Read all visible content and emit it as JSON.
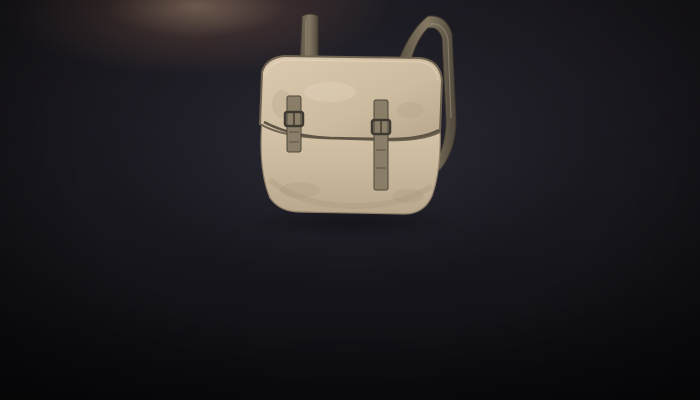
{
  "scene": {
    "item_icon": "canvas-backpack-icon",
    "background_color": "#16151b",
    "glow_color": "#e8b991",
    "canvas_color": "#cdbca3",
    "strap_color": "#6f6553"
  }
}
